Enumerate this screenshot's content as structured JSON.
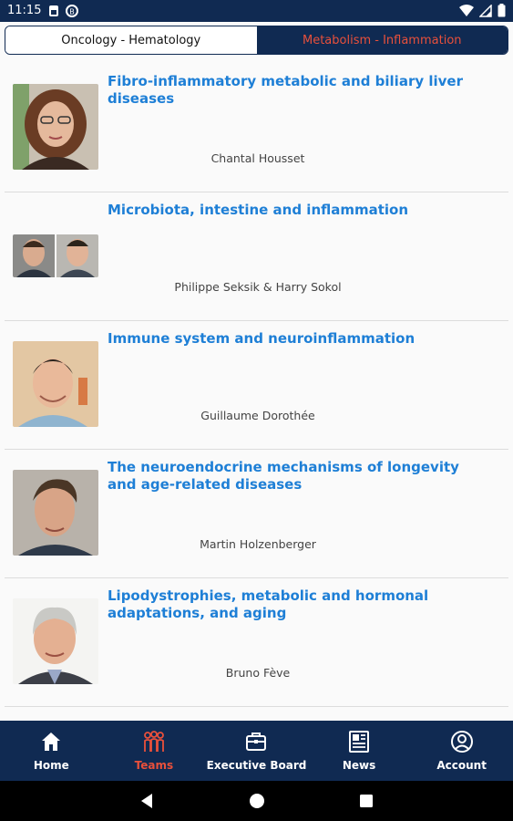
{
  "status_bar": {
    "time": "11:15"
  },
  "tabs": [
    {
      "label": "Oncology - Hematology",
      "active": false
    },
    {
      "label": "Metabolism - Inflammation",
      "active": true
    }
  ],
  "teams": [
    {
      "title": "Fibro-inflammatory metabolic and biliary liver diseases",
      "author": "Chantal Housset",
      "photo": "portrait-woman-glasses"
    },
    {
      "title": "Microbiota, intestine and inflammation",
      "author": "Philippe Seksik & Harry Sokol",
      "photo": "two-portraits"
    },
    {
      "title": "Immune system and neuroinflammation",
      "author": "Guillaume Dorothée",
      "photo": "portrait-man-lab"
    },
    {
      "title": "The neuroendocrine mechanisms of longevity and age-related diseases",
      "author": "Martin Holzenberger",
      "photo": "portrait-man"
    },
    {
      "title": "Lipodystrophies, metabolic and hormonal adaptations, and aging",
      "author": "Bruno Fève",
      "photo": "portrait-man-grey-hair"
    }
  ],
  "bottom_nav": [
    {
      "label": "Home",
      "icon": "home-icon",
      "active": false
    },
    {
      "label": "Teams",
      "icon": "teams-icon",
      "active": true
    },
    {
      "label": "Executive Board",
      "icon": "briefcase-icon",
      "active": false
    },
    {
      "label": "News",
      "icon": "newspaper-icon",
      "active": false
    },
    {
      "label": "Account",
      "icon": "account-icon",
      "active": false
    }
  ],
  "colors": {
    "navy": "#102a52",
    "accent": "#e9503b",
    "link": "#1e7fd6"
  }
}
